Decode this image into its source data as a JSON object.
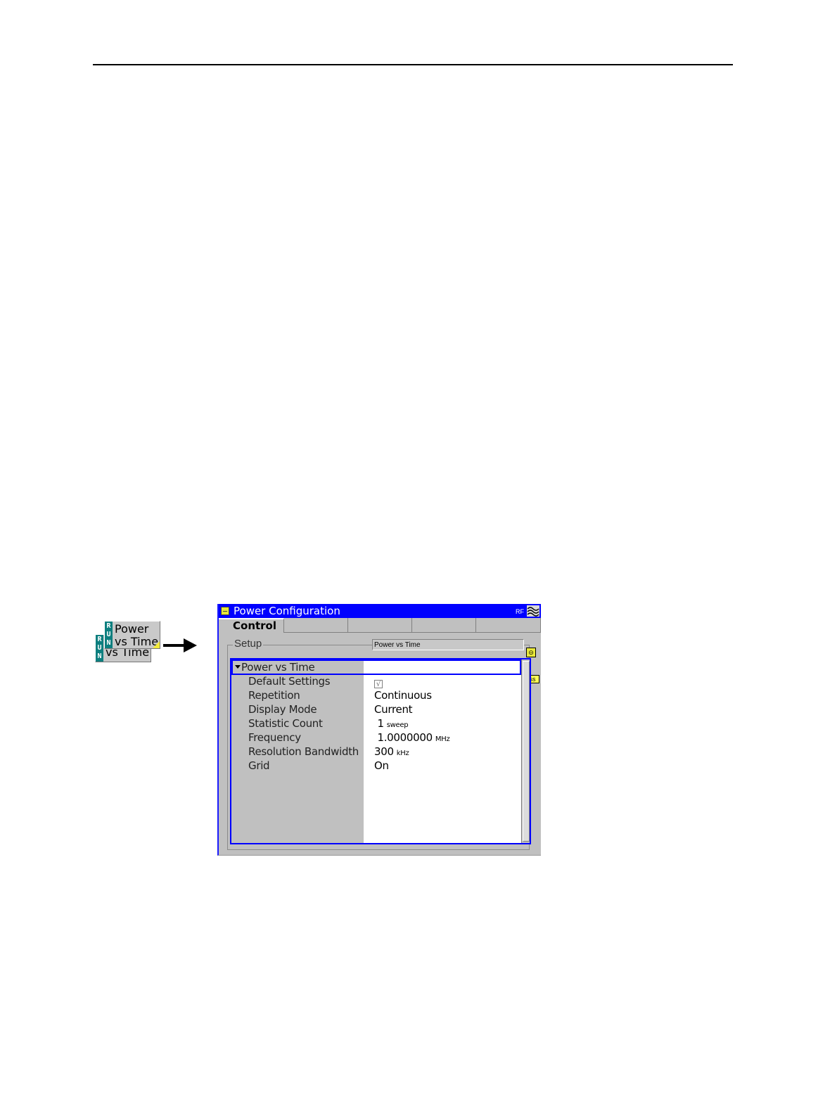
{
  "softkey": {
    "run_letters": [
      "R",
      "U",
      "N"
    ],
    "front_label_line1": "Power",
    "front_label_line2": "vs Time",
    "back_label_line2": "vs Time"
  },
  "window": {
    "title": "Power Configuration",
    "rf_label": "RF",
    "tabs": [
      {
        "label": "Control"
      },
      {
        "label": ""
      },
      {
        "label": ""
      },
      {
        "label": ""
      },
      {
        "label": ""
      }
    ],
    "setup_group_label": "Setup",
    "status_text": "Power vs Time",
    "compress_tooltip": "Compress",
    "tree": {
      "header": "Power vs Time",
      "rows": [
        {
          "name": "Default Settings",
          "value": "√",
          "unit": ""
        },
        {
          "name": "Repetition",
          "value": "Continuous",
          "unit": ""
        },
        {
          "name": "Display Mode",
          "value": "Current",
          "unit": ""
        },
        {
          "name": "Statistic Count",
          "value": "1",
          "unit": "sweep"
        },
        {
          "name": "Frequency",
          "value": "1.0000000",
          "unit": "MHz"
        },
        {
          "name": "Resolution Bandwidth",
          "value": "300",
          "unit": "kHz"
        },
        {
          "name": "Grid",
          "value": "On",
          "unit": ""
        }
      ]
    }
  }
}
